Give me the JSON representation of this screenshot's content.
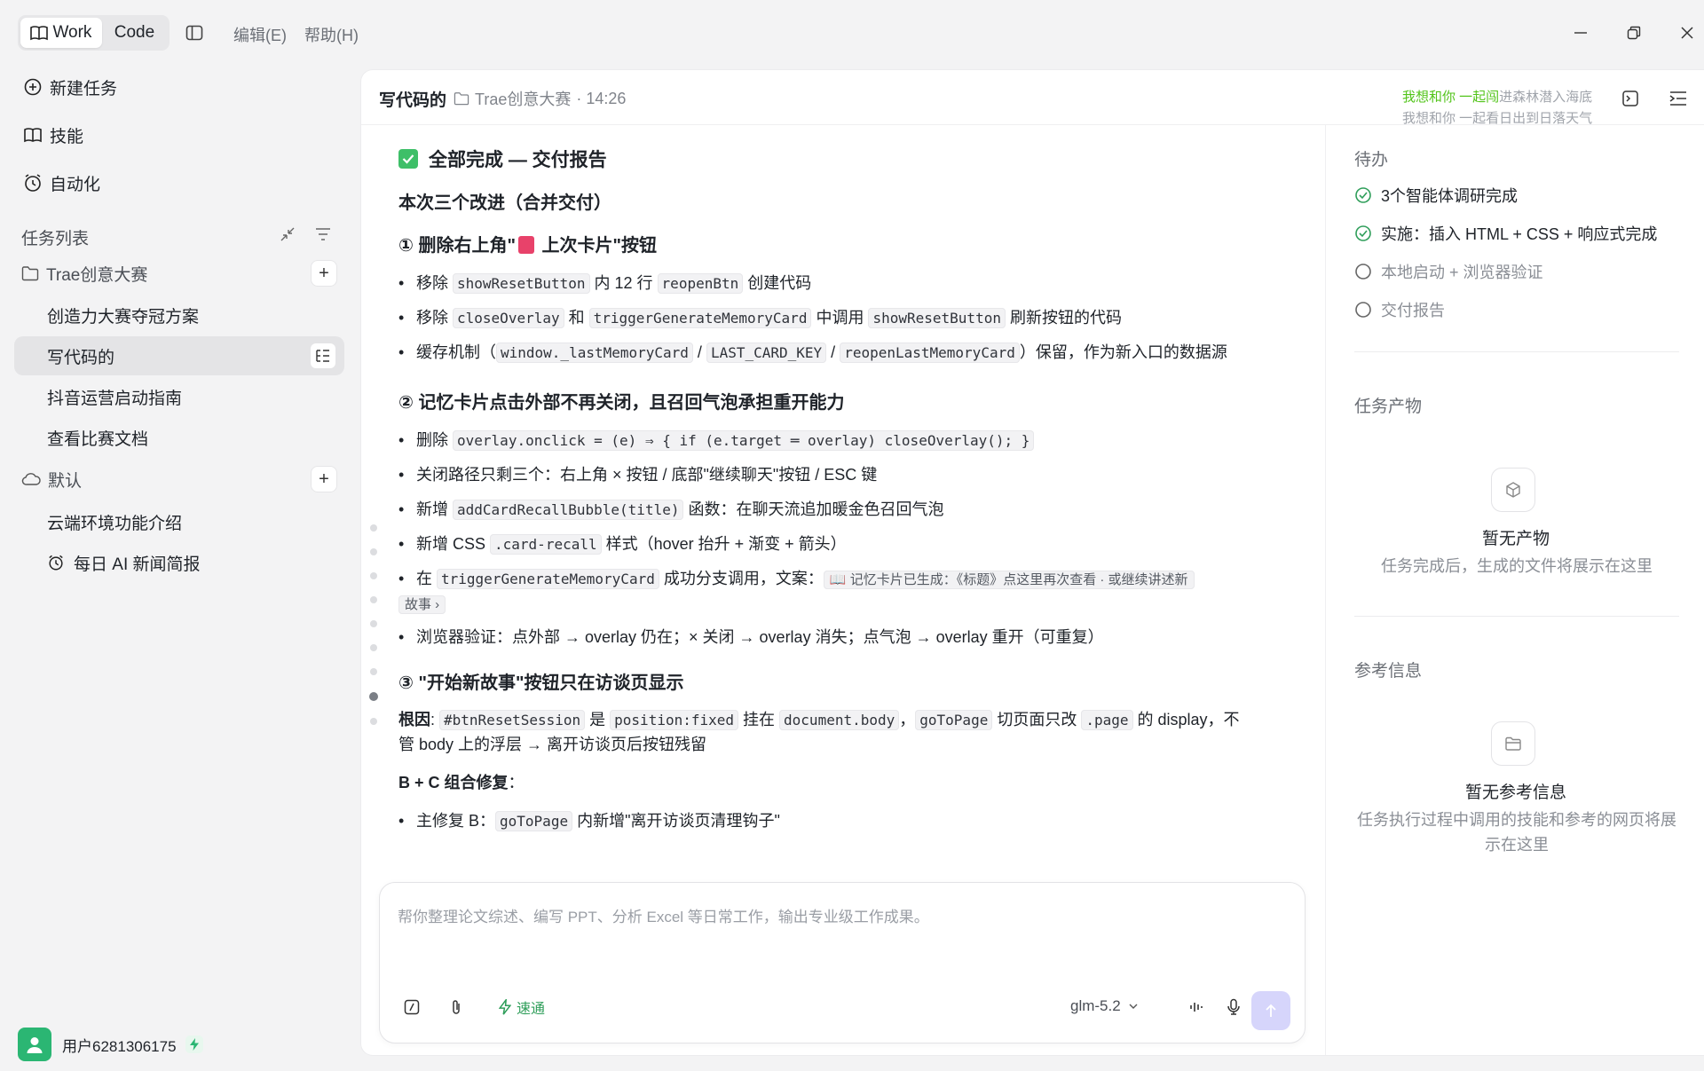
{
  "topbar": {
    "mode_work": "Work",
    "mode_code": "Code",
    "menu_edit": "编辑(E)",
    "menu_help": "帮助(H)"
  },
  "sidebar": {
    "nav": [
      {
        "label": "新建任务",
        "icon": "new-task-icon"
      },
      {
        "label": "技能",
        "icon": "book-icon"
      },
      {
        "label": "自动化",
        "icon": "clock-icon"
      }
    ],
    "task_list_title": "任务列表",
    "groups": [
      {
        "label": "Trae创意大赛",
        "items": [
          "创造力大赛夺冠方案",
          "写代码的",
          "抖音运营启动指南",
          "查看比赛文档"
        ]
      },
      {
        "label": "默认",
        "items": [
          "云端环境功能介绍",
          "每日 AI 新闻简报"
        ]
      }
    ],
    "active_item": "写代码的",
    "user_name": "用户6281306175"
  },
  "header": {
    "title": "写代码的",
    "project": "Trae创意大赛",
    "time": "· 14:26",
    "lyric_line1_highlight": "我想和你 一起闯",
    "lyric_line1_rest": "进森林潜入海底",
    "lyric_line2": "我想和你 一起看日出到日落天气"
  },
  "report": {
    "heading": "全部完成 — 交付报告",
    "subheading": "本次三个改进（合并交付）",
    "s1_title_a": "① 删除右上角\"",
    "s1_title_b": " 上次卡片\"按钮",
    "s1_b1": [
      "移除 ",
      "showResetButton",
      " 内 12 行 ",
      "reopenBtn",
      " 创建代码"
    ],
    "s1_b2": [
      "移除 ",
      "closeOverlay",
      " 和 ",
      "triggerGenerateMemoryCard",
      " 中调用 ",
      "showResetButton",
      " 刷新按钮的代码"
    ],
    "s1_b3": [
      "缓存机制（",
      "window._lastMemoryCard",
      " / ",
      "LAST_CARD_KEY",
      " / ",
      "reopenLastMemoryCard",
      "）保留，作为新入口的数据源"
    ],
    "s2_title": "② 记忆卡片点击外部不再关闭，且召回气泡承担重开能力",
    "s2_b1": [
      "删除 ",
      "overlay.onclick = (e) ⇒ { if (e.target ═ overlay) closeOverlay(); }"
    ],
    "s2_b2": "关闭路径只剩三个：右上角 × 按钮 / 底部\"继续聊天\"按钮 / ESC 键",
    "s2_b3": [
      "新增 ",
      "addCardRecallBubble(title)",
      " 函数：在聊天流追加暖金色召回气泡"
    ],
    "s2_b4": [
      "新增 CSS ",
      ".card-recall",
      " 样式（hover 抬升 + 渐变 + 箭头）"
    ],
    "s2_b5": [
      "在 ",
      "triggerGenerateMemoryCard",
      " 成功分支调用，文案："
    ],
    "s2_b5_chip1": "📖 记忆卡片已生成：《标题》点这里再次查看 · 或继续讲述新",
    "s2_b5_chip2": "故事 ›",
    "s2_b6": "浏览器验证：点外部 → overlay 仍在；× 关闭 → overlay 消失；点气泡 → overlay 重开（可重复）",
    "s3_title": "③ \"开始新故事\"按钮只在访谈页显示",
    "s3_cause_label": "根因",
    "s3_cause": [
      ": ",
      "#btnResetSession",
      " 是 ",
      "position:fixed",
      " 挂在 ",
      "document.body",
      "，",
      "goToPage",
      " 切页面只改 ",
      ".page",
      " 的 display，不"
    ],
    "s3_cause_line2": "管 body 上的浮层 → 离开访谈页后按钮残留",
    "s3_fix_label": "B + C 组合修复",
    "s3_fix_colon": "：",
    "s3_b1": [
      "主修复 B：",
      "goToPage",
      " 内新增\"离开访谈页清理钩子\""
    ]
  },
  "composer": {
    "placeholder": "帮你整理论文综述、编写 PPT、分析 Excel 等日常工作，输出专业级工作成果。",
    "fast_mode": "速通",
    "model": "glm-5.2"
  },
  "right_panel": {
    "todo_title": "待办",
    "todos": [
      {
        "label": "3个智能体调研完成",
        "done": true
      },
      {
        "label": "实施：插入 HTML + CSS + 响应式完成",
        "done": true
      },
      {
        "label": "本地启动 + 浏览器验证",
        "done": false
      },
      {
        "label": "交付报告",
        "done": false
      }
    ],
    "artifacts_title": "任务产物",
    "artifacts_empty_title": "暂无产物",
    "artifacts_empty_desc": "任务完成后，生成的文件将展示在这里",
    "refs_title": "参考信息",
    "refs_empty_title": "暂无参考信息",
    "refs_empty_desc": "任务执行过程中调用的技能和参考的网页将展示在这里"
  },
  "colors": {
    "accent_green": "#2f9e5a",
    "check_green": "#3ebf68",
    "send_button": "#d6d5fb",
    "active_item_bg": "#e4e4e6"
  }
}
